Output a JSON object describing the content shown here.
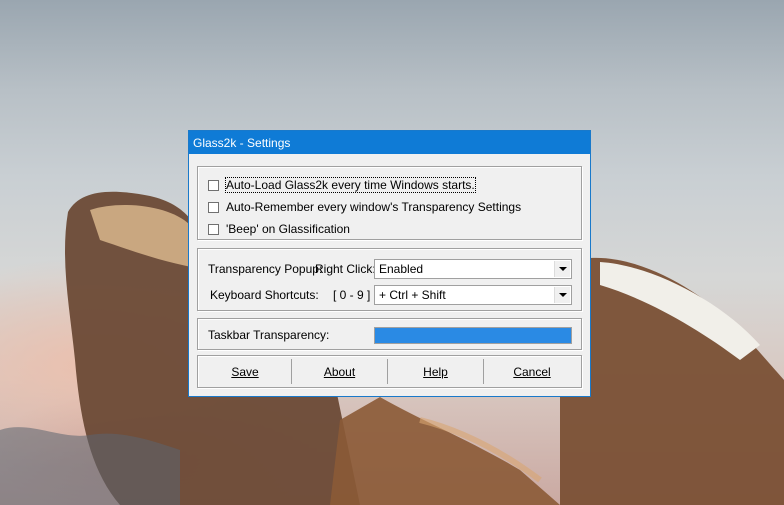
{
  "window": {
    "title": "Glass2k - Settings"
  },
  "options": {
    "autoload_label": "Auto-Load Glass2k every time Windows starts.",
    "autoremember_label": "Auto-Remember every window's Transparency Settings",
    "beep_label": "'Beep' on Glassification"
  },
  "popup": {
    "label": "Transparency Popup:",
    "trigger": "Right Click:",
    "value": "Enabled"
  },
  "shortcuts": {
    "label": "Keyboard Shortcuts:",
    "range": "[ 0 - 9 ] :",
    "value": "+ Ctrl + Shift"
  },
  "taskbar": {
    "label": "Taskbar Transparency:",
    "level_percent": 100
  },
  "buttons": {
    "save": "Save",
    "about": "About",
    "help": "Help",
    "cancel": "Cancel"
  },
  "colors": {
    "titlebar": "#0f7bd6",
    "progress": "#2a8ae4"
  }
}
